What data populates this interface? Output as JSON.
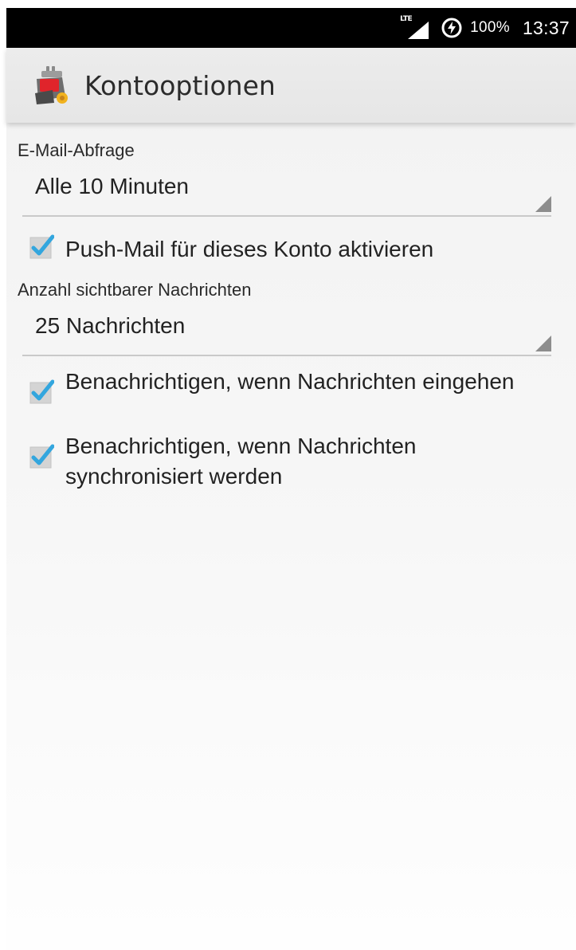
{
  "status_bar": {
    "network_label": "LTE",
    "battery_percent": "100%",
    "time": "13:37",
    "icons": [
      "lte-signal-icon",
      "battery-saver-icon"
    ]
  },
  "action_bar": {
    "title": "Kontooptionen",
    "app_icon": "mail-app-icon"
  },
  "settings": {
    "polling_label": "E-Mail-Abfrage",
    "polling_value": "Alle 10 Minuten",
    "push_label": "Push-Mail für dieses Konto aktivieren",
    "push_checked": true,
    "visible_count_label": "Anzahl sichtbarer Nachrichten",
    "visible_count_value": "25 Nachrichten",
    "notify_incoming_label": "Benachrichtigen, wenn Nachrichten eingehen",
    "notify_incoming_checked": true,
    "notify_sync_label": "Benachrichtigen, wenn Nachrichten synchronisiert werden",
    "notify_sync_checked": true
  },
  "colors": {
    "accent": "#33a6de",
    "status_bar": "#000000",
    "action_bar": "#e9e9e9"
  }
}
